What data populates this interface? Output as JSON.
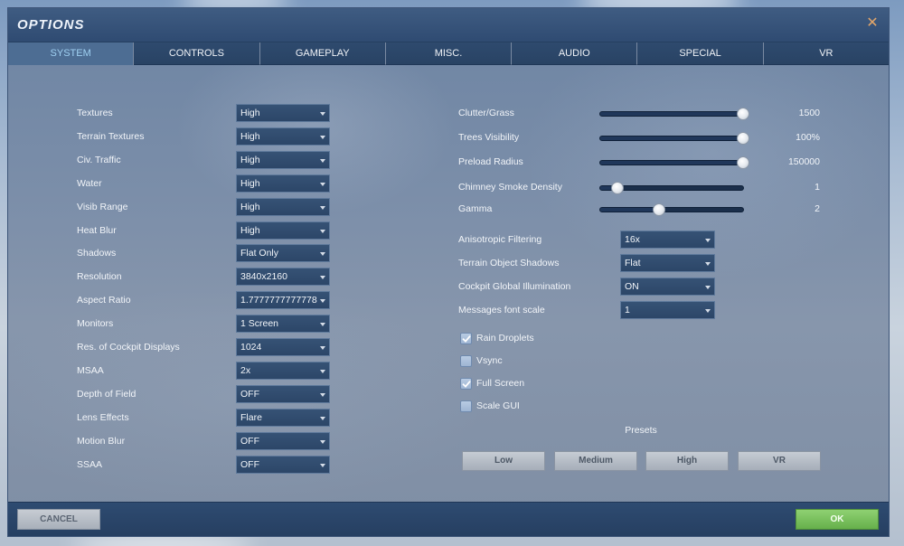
{
  "window": {
    "title": "OPTIONS"
  },
  "tabs": [
    {
      "label": "SYSTEM",
      "active": true
    },
    {
      "label": "CONTROLS",
      "active": false
    },
    {
      "label": "GAMEPLAY",
      "active": false
    },
    {
      "label": "MISC.",
      "active": false
    },
    {
      "label": "AUDIO",
      "active": false
    },
    {
      "label": "SPECIAL",
      "active": false
    },
    {
      "label": "VR",
      "active": false
    }
  ],
  "left_settings": [
    {
      "label": "Textures",
      "value": "High"
    },
    {
      "label": "Terrain Textures",
      "value": "High"
    },
    {
      "label": "Civ. Traffic",
      "value": "High"
    },
    {
      "label": "Water",
      "value": "High"
    },
    {
      "label": "Visib Range",
      "value": "High"
    },
    {
      "label": "Heat Blur",
      "value": "High"
    },
    {
      "label": "Shadows",
      "value": "Flat Only"
    },
    {
      "label": "Resolution",
      "value": "3840x2160"
    },
    {
      "label": "Aspect Ratio",
      "value": "1.7777777777778"
    },
    {
      "label": "Monitors",
      "value": "1 Screen"
    },
    {
      "label": "Res. of Cockpit Displays",
      "value": "1024"
    },
    {
      "label": "MSAA",
      "value": "2x"
    },
    {
      "label": "Depth of Field",
      "value": "OFF"
    },
    {
      "label": "Lens Effects",
      "value": "Flare"
    },
    {
      "label": "Motion Blur",
      "value": "OFF"
    },
    {
      "label": "SSAA",
      "value": "OFF"
    }
  ],
  "sliders": [
    {
      "label": "Clutter/Grass",
      "value": "1500",
      "fraction": 1.0
    },
    {
      "label": "Trees Visibility",
      "value": "100%",
      "fraction": 1.0
    },
    {
      "label": "Preload Radius",
      "value": "150000",
      "fraction": 1.0
    },
    {
      "label": "Chimney Smoke Density",
      "value": "1",
      "fraction": 0.12
    },
    {
      "label": "Gamma",
      "value": "2",
      "fraction": 0.41
    }
  ],
  "right_settings": [
    {
      "label": "Anisotropic Filtering",
      "value": "16x"
    },
    {
      "label": "Terrain Object Shadows",
      "value": "Flat"
    },
    {
      "label": "Cockpit Global Illumination",
      "value": "ON"
    },
    {
      "label": "Messages font scale",
      "value": "1"
    }
  ],
  "checkboxes": [
    {
      "label": "Rain Droplets",
      "checked": true
    },
    {
      "label": "Vsync",
      "checked": false
    },
    {
      "label": "Full Screen",
      "checked": true
    },
    {
      "label": "Scale GUI",
      "checked": false
    }
  ],
  "presets": {
    "label": "Presets",
    "buttons": [
      "Low",
      "Medium",
      "High",
      "VR"
    ]
  },
  "footer": {
    "cancel_label": "CANCEL",
    "ok_label": "OK"
  },
  "colors": {
    "accent_tab": "#9fd0f2",
    "ok": "#74bd58",
    "close": "#e2a66a"
  }
}
